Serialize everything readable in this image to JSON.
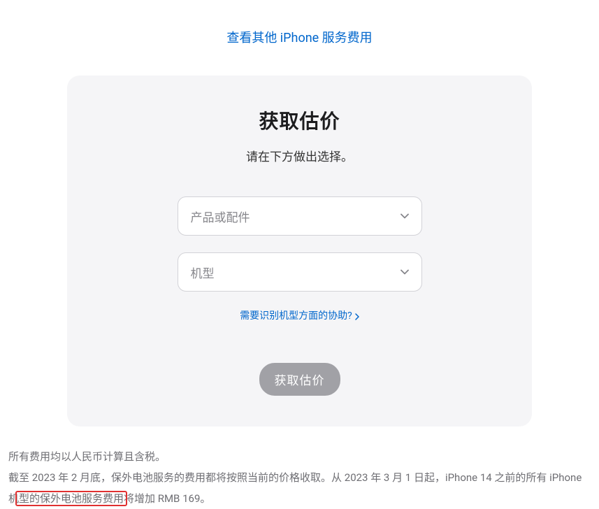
{
  "topLink": {
    "text": "查看其他 iPhone 服务费用"
  },
  "card": {
    "title": "获取估价",
    "subtitle": "请在下方做出选择。",
    "select1": {
      "placeholder": "产品或配件"
    },
    "select2": {
      "placeholder": "机型"
    },
    "helpLink": "需要识别机型方面的协助?",
    "submitButton": "获取估价"
  },
  "footer": {
    "line1": "所有费用均以人民币计算且含税。",
    "line2": "截至 2023 年 2 月底，保外电池服务的费用都将按照当前的价格收取。从 2023 年 3 月 1 日起，iPhone 14 之前的所有 iPhone 机型的保外电池服务费用将增加 RMB 169。"
  }
}
